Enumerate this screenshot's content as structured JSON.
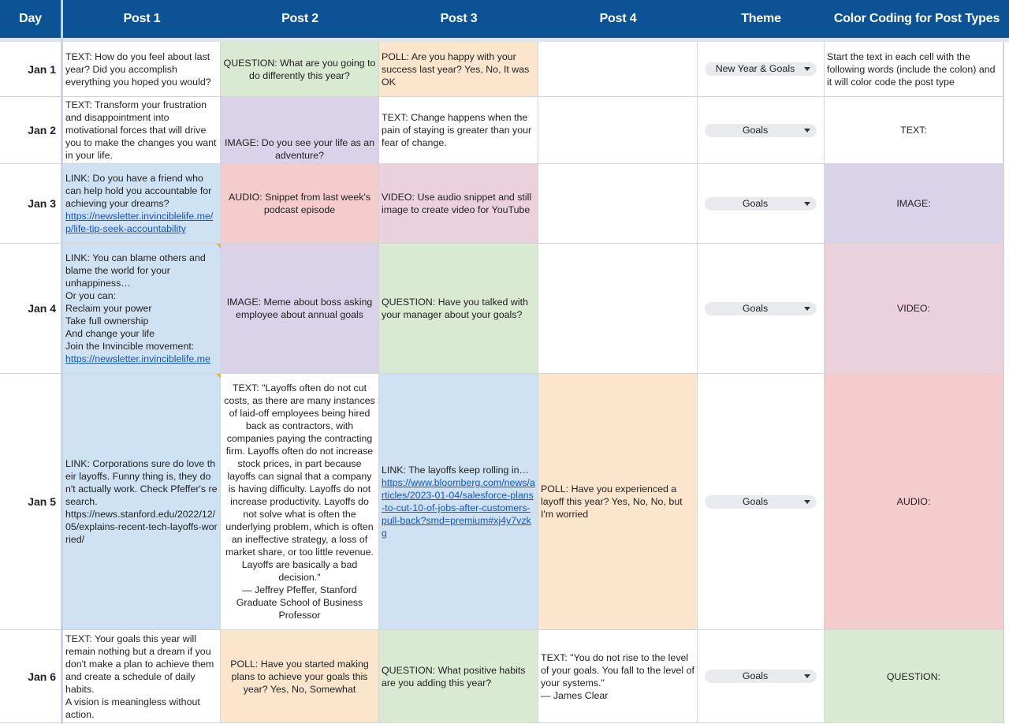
{
  "columns": {
    "day": "Day",
    "post1": "Post 1",
    "post2": "Post 2",
    "post3": "Post 3",
    "post4": "Post 4",
    "theme": "Theme",
    "legend": "Color Coding for Post Types"
  },
  "post_type_colors": {
    "TEXT": "#ffffff",
    "QUESTION": "#d9ead3",
    "POLL": "#fce5cd",
    "IMAGE": "#d9d2e9",
    "LINK": "#cfe2f3",
    "AUDIO": "#f4cccc",
    "VIDEO": "#ead1dc",
    "header": "#0b5394"
  },
  "rows": [
    {
      "day": "Jan 1",
      "post1": {
        "type": "TEXT",
        "text": "TEXT: How do you feel about last year? Did you accomplish everything you hoped you would?"
      },
      "post2": {
        "type": "QUESTION",
        "text": "QUESTION: What are you going to do differently this year?"
      },
      "post3": {
        "type": "POLL",
        "text": "POLL: Are you happy with your success last year? Yes, No, It was OK"
      },
      "post4": {
        "type": "",
        "text": ""
      },
      "theme": "New Year & Goals",
      "legend": {
        "type": "TEXT",
        "text": "Start the text in each cell with the following words (include the colon) and it will color code the post type"
      }
    },
    {
      "day": "Jan 2",
      "post1": {
        "type": "TEXT",
        "text": "TEXT: Transform your frustration and disappointment into motivational forces that will drive you to make the changes you want in your life."
      },
      "post2": {
        "type": "IMAGE",
        "text": "IMAGE: Do you see your life as an adventure?"
      },
      "post3": {
        "type": "TEXT",
        "text": "TEXT: Change happens when the pain of staying is greater than your fear of change."
      },
      "post4": {
        "type": "",
        "text": ""
      },
      "theme": "Goals",
      "legend": {
        "type": "TEXT",
        "text": "TEXT:"
      }
    },
    {
      "day": "Jan 3",
      "post1": {
        "type": "LINK",
        "text": "LINK: Do you have a friend who can help hold you accountable for achieving your dreams?",
        "link": "https://newsletter.invinciblelife.me/p/life-tip-seek-accountability"
      },
      "post2": {
        "type": "AUDIO",
        "text": "AUDIO: Snippet from last week's podcast episode"
      },
      "post3": {
        "type": "VIDEO",
        "text": "VIDEO: Use audio snippet and still image to create video for YouTube"
      },
      "post4": {
        "type": "",
        "text": ""
      },
      "theme": "Goals",
      "legend": {
        "type": "IMAGE",
        "text": "IMAGE:"
      }
    },
    {
      "day": "Jan 4",
      "post1": {
        "type": "LINK",
        "text": "LINK: You can blame others and blame the world for your unhappiness…\nOr you can:\nReclaim your power\nTake full ownership\nAnd change your life\nJoin the Invincible movement:",
        "link": "https://newsletter.invinciblelife.me"
      },
      "post2": {
        "type": "IMAGE",
        "text": "IMAGE: Meme about boss asking employee about annual goals"
      },
      "post3": {
        "type": "QUESTION",
        "text": "QUESTION: Have you talked with your manager about your goals?"
      },
      "post4": {
        "type": "",
        "text": ""
      },
      "theme": "Goals",
      "legend": {
        "type": "VIDEO",
        "text": "VIDEO:"
      }
    },
    {
      "day": "Jan 5",
      "post1": {
        "type": "LINK",
        "text": "LINK: Corporations sure do love their layoffs. Funny thing is, they don't actually work. Check Pfeffer's research.\nhttps://news.stanford.edu/2022/12/05/explains-recent-tech-layoffs-worried/"
      },
      "post2": {
        "type": "TEXT",
        "text": "TEXT: \"Layoffs often do not cut costs, as there are many instances of laid-off employees being hired back as contractors, with companies paying the contracting firm. Layoffs often do not increase stock prices, in part because layoffs can signal that a company is having difficulty. Layoffs do not increase productivity. Layoffs do not solve what is often the underlying problem, which is often an ineffective strategy, a loss of market share, or too little revenue. Layoffs are basically a bad decision.\"\n— Jeffrey Pfeffer, Stanford Graduate School of Business Professor"
      },
      "post3": {
        "type": "LINK",
        "text": "LINK: The layoffs keep rolling in…",
        "link": "https://www.bloomberg.com/news/articles/2023-01-04/salesforce-plans-to-cut-10-of-jobs-after-customers-pull-back?smd=premium#xj4y7vzkg"
      },
      "post4": {
        "type": "POLL",
        "text": "POLL: Have you experienced a layoff this year? Yes, No, No, but I'm worried"
      },
      "theme": "Goals",
      "legend": {
        "type": "AUDIO",
        "text": "AUDIO:"
      }
    },
    {
      "day": "Jan 6",
      "post1": {
        "type": "TEXT",
        "text": "TEXT: Your goals this year will remain nothing but a dream if you don't make a plan to achieve them and create a schedule of daily habits.\nA vision is meaningless without action."
      },
      "post2": {
        "type": "POLL",
        "text": "POLL: Have you started making plans to achieve your goals this year? Yes, No, Somewhat"
      },
      "post3": {
        "type": "QUESTION",
        "text": "QUESTION: What positive habits are you adding this year?"
      },
      "post4": {
        "type": "TEXT",
        "text": "TEXT: \"You do not rise to the level of your goals. You fall to the level of your systems.\"\n— James Clear"
      },
      "theme": "Goals",
      "legend": {
        "type": "QUESTION",
        "text": "QUESTION:"
      }
    }
  ]
}
